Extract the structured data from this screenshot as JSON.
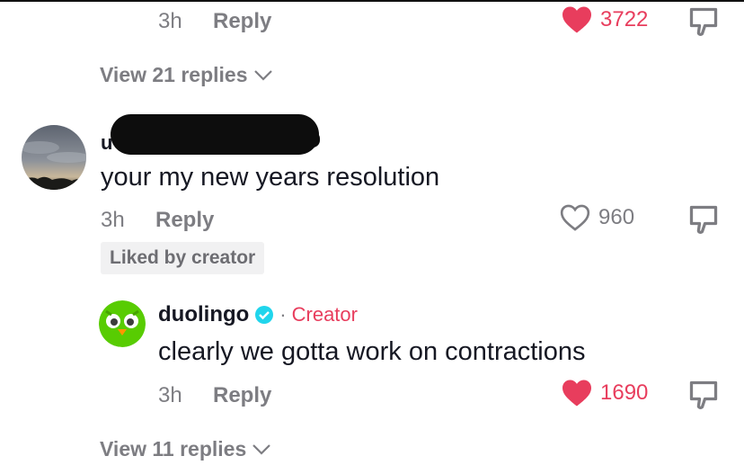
{
  "comment_top": {
    "time": "3h",
    "reply_label": "Reply",
    "likes": "3722",
    "view_replies": "View 21 replies"
  },
  "comment_main": {
    "username_visible": "u",
    "text": "your my new years resolution",
    "time": "3h",
    "reply_label": "Reply",
    "likes": "960",
    "liked_by_creator": "Liked by creator"
  },
  "reply_duolingo": {
    "username": "duolingo",
    "separator": "·",
    "creator_label": "Creator",
    "text": "clearly we gotta work on contractions",
    "time": "3h",
    "reply_label": "Reply",
    "likes": "1690",
    "view_replies": "View 11 replies"
  },
  "colors": {
    "like_red": "#e83d5d",
    "muted": "#7d7d82",
    "duolingo_green": "#58cc02",
    "verified_blue": "#20d5ec"
  }
}
